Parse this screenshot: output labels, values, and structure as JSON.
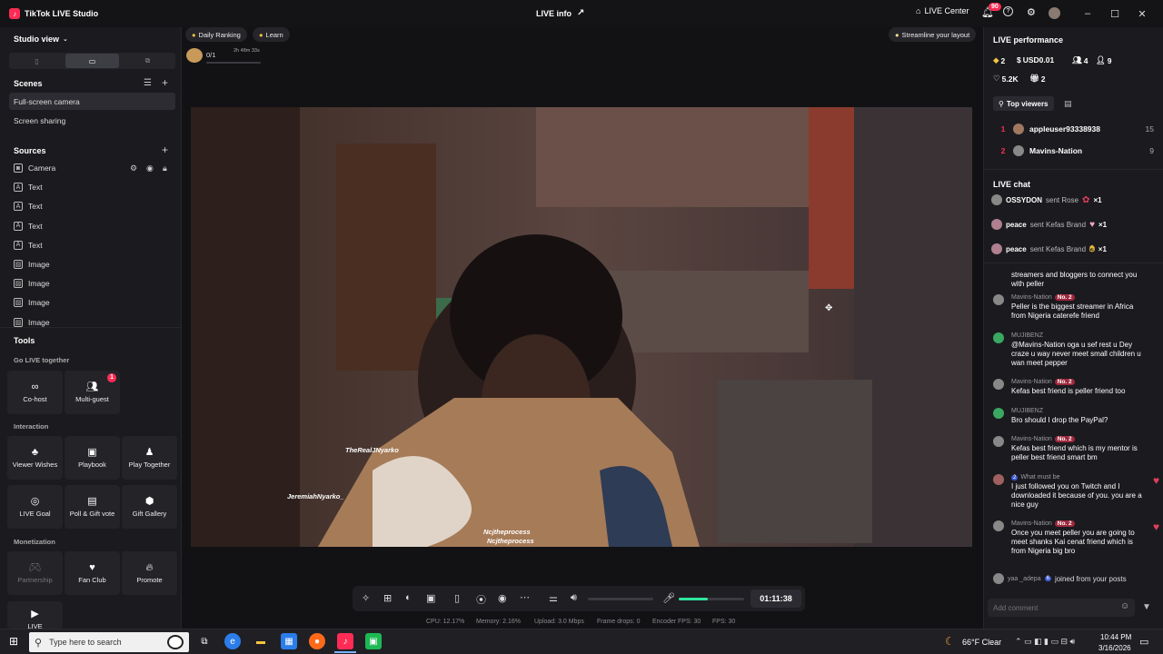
{
  "app": {
    "title": "TikTok LIVE Studio",
    "center_title": "LIVE info",
    "live_center": "LIVE Center",
    "notif_count": "90"
  },
  "left": {
    "studio_view": "Studio view",
    "scenes_title": "Scenes",
    "scenes": [
      "Full-screen camera",
      "Screen sharing"
    ],
    "sources_title": "Sources",
    "sources": [
      {
        "label": "Camera",
        "icon": "camera-icon"
      },
      {
        "label": "Text",
        "icon": "text-icon"
      },
      {
        "label": "Text",
        "icon": "text-icon"
      },
      {
        "label": "Text",
        "icon": "text-icon"
      },
      {
        "label": "Text",
        "icon": "text-icon"
      },
      {
        "label": "Image",
        "icon": "image-icon"
      },
      {
        "label": "Image",
        "icon": "image-icon"
      },
      {
        "label": "Image",
        "icon": "image-icon"
      },
      {
        "label": "Image",
        "icon": "image-icon"
      }
    ],
    "tools_title": "Tools",
    "go_live_together": "Go LIVE together",
    "interaction": "Interaction",
    "monetization": "Monetization",
    "tools": {
      "cohost": "Co-host",
      "multiguest": "Multi-guest",
      "multiguest_badge": "1",
      "viewer_wishes": "Viewer Wishes",
      "playbook": "Playbook",
      "play_together": "Play Together",
      "live_goal": "LIVE Goal",
      "poll_gift_vote": "Poll & Gift vote",
      "gift_gallery": "Gift Gallery",
      "partnership": "Partnership",
      "fan_club": "Fan Club",
      "promote": "Promote",
      "live": "LIVE"
    }
  },
  "center": {
    "daily_ranking": "Daily Ranking",
    "learn": "Learn",
    "goal_progress": "0/1",
    "goal_timer": "2h 48m 33s",
    "streamline": "Streamline your layout",
    "overlays": [
      "TheRealJNyarko",
      "JeremiahNyarko_",
      "Ncjtheprocess",
      "Ncjtheprocess"
    ],
    "timer": "01:11:38",
    "volume_level": 0.45,
    "stats": {
      "cpu": "CPU: 12.17%",
      "memory": "Memory: 2.16%",
      "upload": "Upload: 3.0 Mbps",
      "frame_drops": "Frame drops: 0",
      "encoder_fps": "Encoder FPS: 30",
      "fps": "FPS: 30"
    }
  },
  "right": {
    "live_performance": "LIVE performance",
    "metrics": {
      "diamonds": "2",
      "usd": "USD0.01",
      "viewers": "4",
      "new_followers": "9",
      "likes": "5.2K",
      "gifters": "2"
    },
    "top_viewers": "Top viewers",
    "viewers": [
      {
        "rank": "1",
        "name": "appleuser93338938",
        "score": "15"
      },
      {
        "rank": "2",
        "name": "Mavins-Nation",
        "score": "9"
      }
    ],
    "live_chat": "LIVE chat",
    "gifts": [
      {
        "user": "OSSYDON",
        "text": "sent Rose",
        "count": "×1"
      },
      {
        "user": "peace",
        "text": "sent Kefas Brand",
        "count": "×1"
      },
      {
        "user": "peace",
        "text": "sent Kefas Brand",
        "count": "×1"
      }
    ],
    "partial_message": "streamers and bloggers to connect you with peller",
    "messages": [
      {
        "user": "Mavins-Nation",
        "rank": "No. 2",
        "text": "Peller is the biggest streamer in Africa from Nigeria caterefe friend"
      },
      {
        "user": "MUJIBENZ",
        "rank": "",
        "text": "@Mavins-Nation oga u sef rest u Dey craze u way never meet small children u wan meet pepper"
      },
      {
        "user": "Mavins-Nation",
        "rank": "No. 2",
        "text": "Kefas best friend is peller friend too"
      },
      {
        "user": "MUJIBENZ",
        "rank": "",
        "text": "Bro should I drop the PayPal?"
      },
      {
        "user": "Mavins-Nation",
        "rank": "No. 2",
        "text": "Kefas best friend which is my mentor is peller best friend smart bm"
      },
      {
        "user": "What must be",
        "rank": "",
        "level": "2",
        "text": "I just followed you on Twitch and I downloaded it because of you. you are a nice guy"
      },
      {
        "user": "Mavins-Nation",
        "rank": "No. 2",
        "text": "Once you meet peller you are going to meet shanks Kai cenat friend which is from Nigeria big bro"
      }
    ],
    "join_user": "yaa _adepa",
    "join_level": "6",
    "join_text": "joined from your posts",
    "add_comment_placeholder": "Add comment"
  },
  "taskbar": {
    "search_placeholder": "Type here to search",
    "weather": "66°F Clear",
    "time": "10:44 PM",
    "date": "3/16/2026"
  },
  "colors": {
    "accent": "#fe2c55",
    "panel": "#1b1b1f",
    "volume": "#2ee59d"
  }
}
